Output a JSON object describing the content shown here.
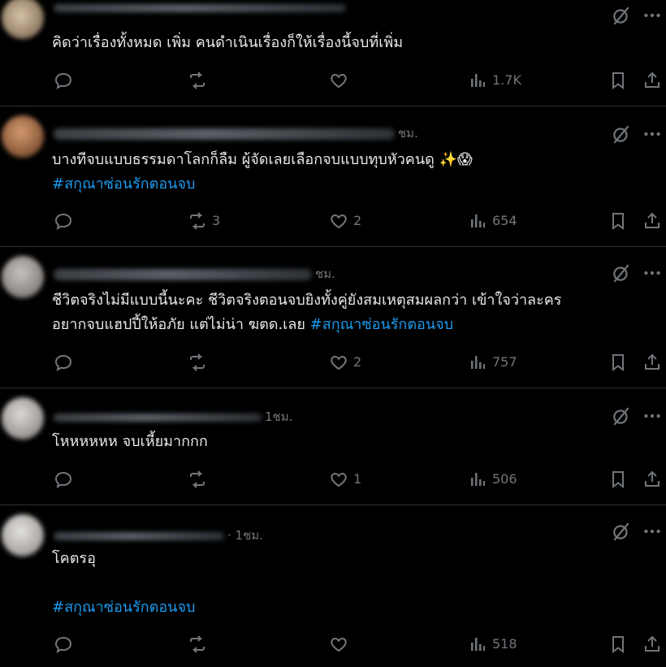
{
  "colors": {
    "background": "#000000",
    "text": "#e7e9ea",
    "muted": "#71767b",
    "hashtag": "#1d9bf0",
    "divider": "#2f3336"
  },
  "icons": {
    "reply": "reply-icon",
    "retweet": "retweet-icon",
    "like": "heart-icon",
    "views": "views-icon",
    "bookmark": "bookmark-icon",
    "share": "share-icon",
    "grok": "grok-icon",
    "more": "more-icon"
  },
  "posts": [
    {
      "time": "",
      "lines": [
        "คิดว่าเรื่องทั้งหมด เพิ่ม คนดำเนินเรื่องก็ให้เรื่องนี้จบที่เพิ่ม"
      ],
      "hashtag": "",
      "replies": "",
      "retweets": "",
      "likes": "",
      "views": "1.7K"
    },
    {
      "time": "ชม.",
      "lines": [
        "บางทีจบแบบธรรมดาโลกก็ลืม ผู้จัดเลยเลือกจบแบบทุบหัวคนดู ✨😱"
      ],
      "hashtag": "#สกุณาซ่อนรักตอนจบ",
      "replies": "",
      "retweets": "3",
      "likes": "2",
      "views": "654"
    },
    {
      "time": "ชม.",
      "lines": [
        "ชีวิตจริงไม่มีแบบนี้นะคะ ชีวิตจริงตอนจบยิงทั้งคู่ยังสมเหตุสมผลกว่า เข้าใจว่าละคร",
        "อยากจบแฮปปี้ให้อภัย แต่ไม่น่า ฆตด.เลย"
      ],
      "hashtag": "#สกุณาซ่อนรักตอนจบ",
      "replies": "",
      "retweets": "",
      "likes": "2",
      "views": "757"
    },
    {
      "time": "1ชม.",
      "lines": [
        "โหหหหหห จบเหี้ยมากกก"
      ],
      "hashtag": "",
      "replies": "",
      "retweets": "",
      "likes": "1",
      "views": "506"
    },
    {
      "time": "· 1ชม.",
      "lines": [
        "โคตรอุ"
      ],
      "hashtag": "#สกุณาซ่อนรักตอนจบ",
      "replies": "",
      "retweets": "",
      "likes": "",
      "views": "518"
    }
  ]
}
